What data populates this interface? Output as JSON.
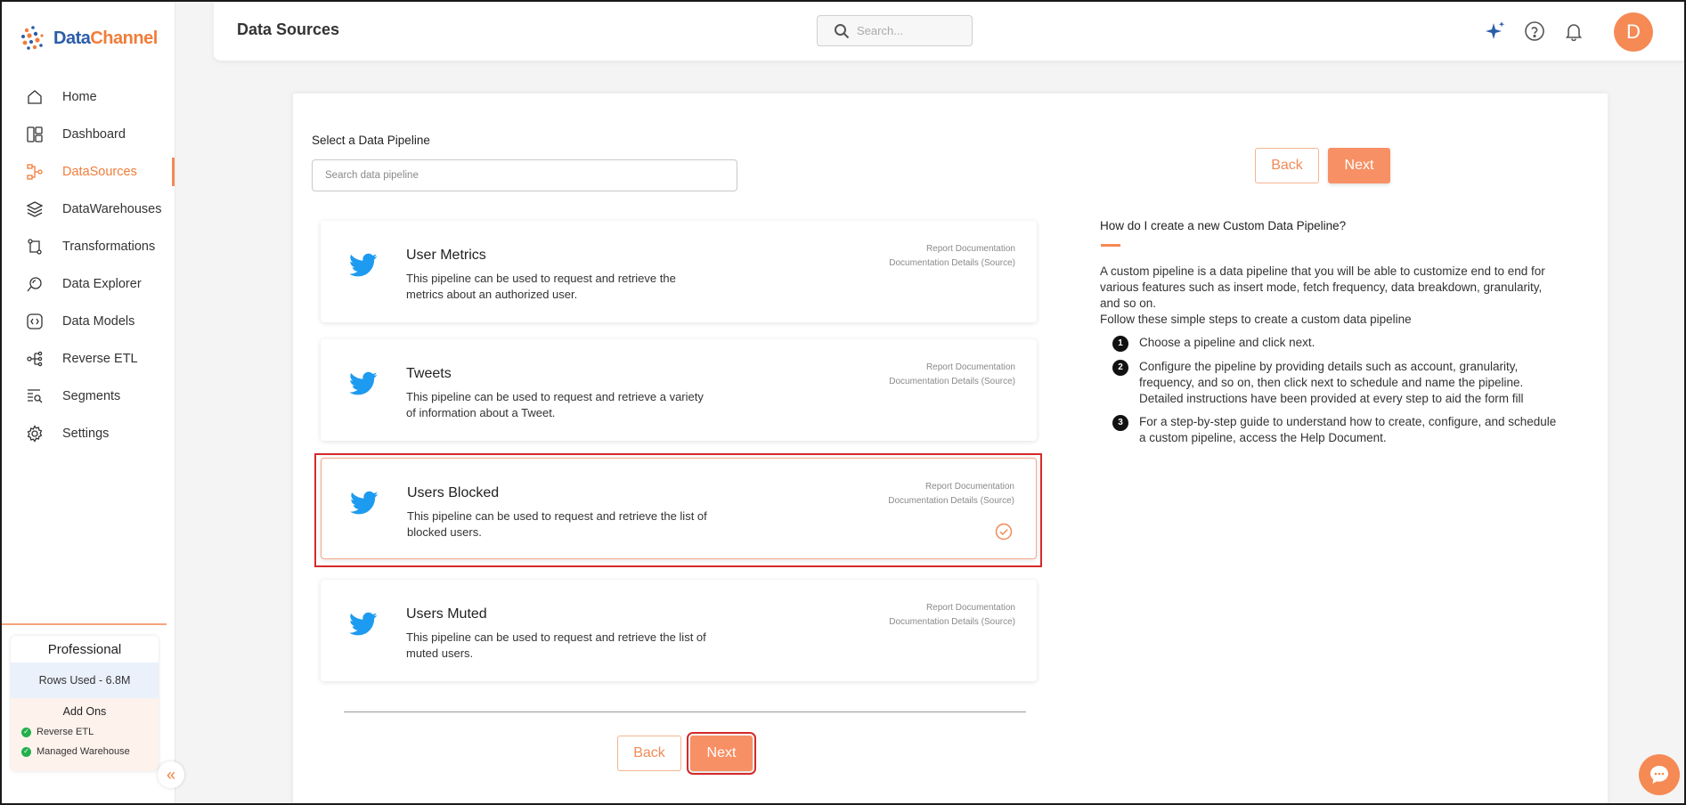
{
  "app": {
    "logo_text_a": "Data",
    "logo_text_b": "Channel",
    "brand_orange": "#f58a55",
    "brand_blue": "#2a5da8"
  },
  "sidebar": {
    "items": [
      {
        "label": "Home",
        "icon": "home-icon",
        "active": false
      },
      {
        "label": "Dashboard",
        "icon": "dashboard-icon",
        "active": false
      },
      {
        "label": "DataSources",
        "icon": "datasources-icon",
        "active": true
      },
      {
        "label": "DataWarehouses",
        "icon": "layers-icon",
        "active": false
      },
      {
        "label": "Transformations",
        "icon": "transform-icon",
        "active": false
      },
      {
        "label": "Data Explorer",
        "icon": "explorer-icon",
        "active": false
      },
      {
        "label": "Data Models",
        "icon": "models-icon",
        "active": false
      },
      {
        "label": "Reverse ETL",
        "icon": "reverse-etl-icon",
        "active": false
      },
      {
        "label": "Segments",
        "icon": "segments-icon",
        "active": false
      },
      {
        "label": "Settings",
        "icon": "gear-icon",
        "active": false
      }
    ],
    "plan": {
      "name": "Professional",
      "rows_used": "Rows Used - 6.8M",
      "addons_title": "Add Ons",
      "addons": [
        "Reverse ETL",
        "Managed Warehouse"
      ]
    }
  },
  "header": {
    "title": "Data Sources",
    "search_placeholder": "Search...",
    "avatar_letter": "D"
  },
  "main": {
    "select_label": "Select a Data Pipeline",
    "search_placeholder": "Search data pipeline",
    "back_label": "Back",
    "next_label": "Next",
    "pipelines": [
      {
        "title": "User Metrics",
        "description": "This pipeline can be used to request and retrieve the metrics about an authorized user.",
        "link1": "Report Documentation",
        "link2": "Documentation Details (Source)",
        "selected": false
      },
      {
        "title": "Tweets",
        "description": "This pipeline can be used to request and retrieve a variety of information about a Tweet.",
        "link1": "Report Documentation",
        "link2": "Documentation Details (Source)",
        "selected": false
      },
      {
        "title": "Users Blocked",
        "description": "This pipeline can be used to request and retrieve the list of blocked users.",
        "link1": "Report Documentation",
        "link2": "Documentation Details (Source)",
        "selected": true
      },
      {
        "title": "Users Muted",
        "description": "This pipeline can be used to request and retrieve the list of muted users.",
        "link1": "Report Documentation",
        "link2": "Documentation Details (Source)",
        "selected": false
      }
    ]
  },
  "help": {
    "title": "How do I create a new Custom Data Pipeline?",
    "intro": "A custom pipeline is a data pipeline that you will be able to customize end to end for various features such as insert mode, fetch frequency, data breakdown, granularity, and so on.",
    "intro2": "Follow these simple steps to create a custom data pipeline",
    "steps": [
      {
        "num": "1",
        "text": "Choose a pipeline and click next."
      },
      {
        "num": "2",
        "text": "Configure the pipeline by providing details such as account, granularity, frequency, and so on, then click next to schedule and name the pipeline. Detailed instructions have been provided at every step to aid the form fill"
      },
      {
        "num": "3",
        "text": "For a step-by-step guide to understand how to create, configure, and schedule a custom pipeline, access the Help Document."
      }
    ]
  }
}
